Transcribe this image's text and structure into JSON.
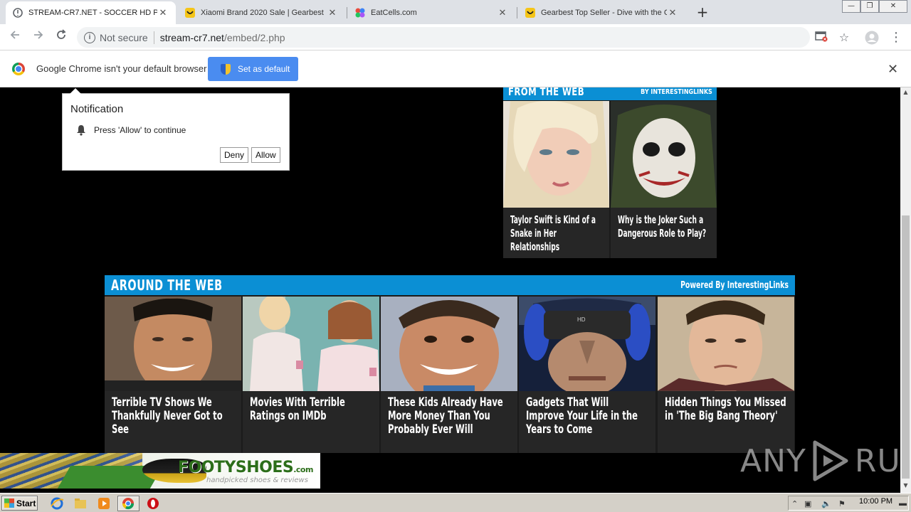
{
  "browser": {
    "tabs": [
      {
        "title": "STREAM-CR7.NET - SOCCER HD Pla",
        "favicon": "globe-icon",
        "active": true
      },
      {
        "title": "Xiaomi Brand 2020 Sale | Gearbest",
        "favicon": "gearbest-icon",
        "active": false
      },
      {
        "title": "EatCells.com",
        "favicon": "eatcells-icon",
        "active": false
      },
      {
        "title": "Gearbest Top Seller - Dive with the C",
        "favicon": "gearbest-icon",
        "active": false
      }
    ],
    "new_tab_label": "+",
    "window_controls": [
      "minimize",
      "restore",
      "close"
    ],
    "address": {
      "security_label": "Not secure",
      "host": "stream-cr7.net",
      "path": "/embed/2.php"
    }
  },
  "infobar": {
    "message": "Google Chrome isn't your default browser",
    "button_label": "Set as default",
    "close_label": "✕"
  },
  "notification": {
    "title": "Notification",
    "message": "Press 'Allow' to continue",
    "deny_label": "Deny",
    "allow_label": "Allow"
  },
  "from_the_web": {
    "title": "FROM THE WEB",
    "by": "BY INTERESTINGLINKS",
    "cards": [
      {
        "caption": "Taylor Swift is Kind of a Snake in Her Relationships",
        "image": "blonde-woman-photo"
      },
      {
        "caption": "Why is the Joker Such a Dangerous Role to Play?",
        "image": "joker-photo"
      }
    ]
  },
  "around_the_web": {
    "title": "AROUND THE WEB",
    "by": "Powered By InterestingLinks",
    "cards": [
      {
        "caption": "Terrible TV Shows We Thankfully Never Got to See",
        "image": "smiling-man-photo"
      },
      {
        "caption": "Movies With Terrible Ratings on IMDb",
        "image": "movie-scene-photo"
      },
      {
        "caption": "These Kids Already Have More Money Than You Probably Ever Will",
        "image": "smiling-kid-photo"
      },
      {
        "caption": "Gadgets That Will Improve Your Life in the Years to Come",
        "image": "vr-headset-photo"
      },
      {
        "caption": "Hidden Things You Missed in 'The Big Bang Theory'",
        "image": "sheldon-photo"
      }
    ]
  },
  "footer_ad": {
    "brand": "FOOTYSHOES",
    "brand_suffix": ".com",
    "tagline": "handpicked shoes & reviews"
  },
  "watermark": {
    "left": "ANY",
    "right": "RUN"
  },
  "taskbar": {
    "start_label": "Start",
    "clock": "10:00 PM"
  },
  "colors": {
    "widget_header": "#0b8fd4",
    "card_bg": "#262626",
    "infobar_button": "#4a8cf0"
  }
}
